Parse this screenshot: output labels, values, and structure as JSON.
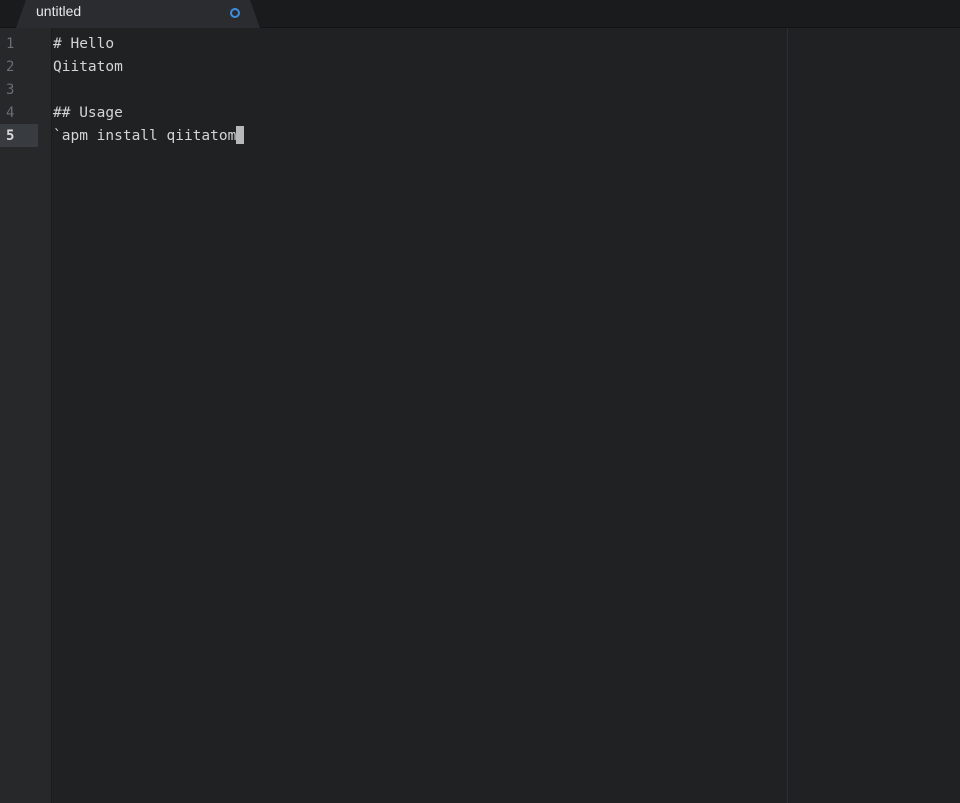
{
  "tab": {
    "title": "untitled",
    "modified_indicator": "modified-dot"
  },
  "gutter": {
    "line_numbers": [
      "1",
      "2",
      "3",
      "4",
      "5"
    ],
    "current_line": "5"
  },
  "editor": {
    "lines": [
      "# Hello",
      "Qiitatom",
      "",
      "## Usage",
      "`apm install qiitatom"
    ],
    "cursor_char": "`"
  },
  "colors": {
    "background": "#1f2123",
    "gutter": "#26282a",
    "text": "#d4d4d4",
    "accent": "#3d8fe0"
  }
}
